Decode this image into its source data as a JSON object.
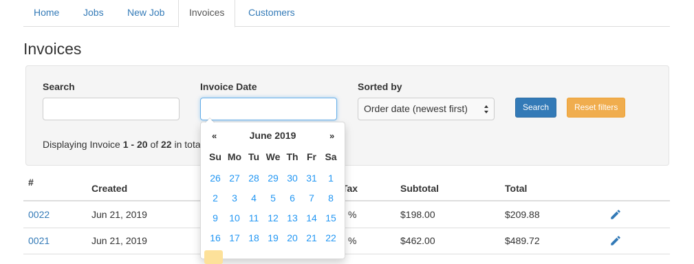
{
  "nav": {
    "tabs": [
      {
        "label": "Home"
      },
      {
        "label": "Jobs"
      },
      {
        "label": "New Job"
      },
      {
        "label": "Invoices"
      },
      {
        "label": "Customers"
      }
    ]
  },
  "page": {
    "title": "Invoices"
  },
  "filters": {
    "search_label": "Search",
    "search_value": "",
    "invoice_date_label": "Invoice Date",
    "invoice_date_value": "",
    "sorted_by_label": "Sorted by",
    "sorted_by_value": "Order date (newest first)",
    "search_button": "Search",
    "reset_button": "Reset filters",
    "displaying_prefix": "Displaying Invoice",
    "displaying_range": "1 - 20",
    "displaying_of": "of",
    "displaying_total": "22",
    "displaying_suffix": "in tota"
  },
  "table": {
    "headers": {
      "number": "#",
      "created": "Created",
      "tax": "Tax",
      "subtotal": "Subtotal",
      "total": "Total"
    },
    "rows": [
      {
        "number": "0022",
        "created": "Jun 21, 2019",
        "tax": "%",
        "subtotal": "$198.00",
        "total": "$209.88"
      },
      {
        "number": "0021",
        "created": "Jun 21, 2019",
        "tax": "%",
        "subtotal": "$462.00",
        "total": "$489.72"
      }
    ]
  },
  "datepicker": {
    "prev": "«",
    "next": "»",
    "month_title": "June 2019",
    "weekdays": [
      "Su",
      "Mo",
      "Tu",
      "We",
      "Th",
      "Fr",
      "Sa"
    ],
    "weeks": [
      [
        "26",
        "27",
        "28",
        "29",
        "30",
        "31",
        "1"
      ],
      [
        "2",
        "3",
        "4",
        "5",
        "6",
        "7",
        "8"
      ],
      [
        "9",
        "10",
        "11",
        "12",
        "13",
        "14",
        "15"
      ],
      [
        "16",
        "17",
        "18",
        "19",
        "20",
        "21",
        "22"
      ]
    ]
  },
  "colors": {
    "link": "#337ab7",
    "primary": "#337ab7",
    "warning": "#f0ad4e",
    "day": "#2196f3",
    "today_highlight": "#fde19a"
  },
  "icons": {
    "edit": "pencil-icon",
    "select": "chevron-up-down-icon"
  }
}
